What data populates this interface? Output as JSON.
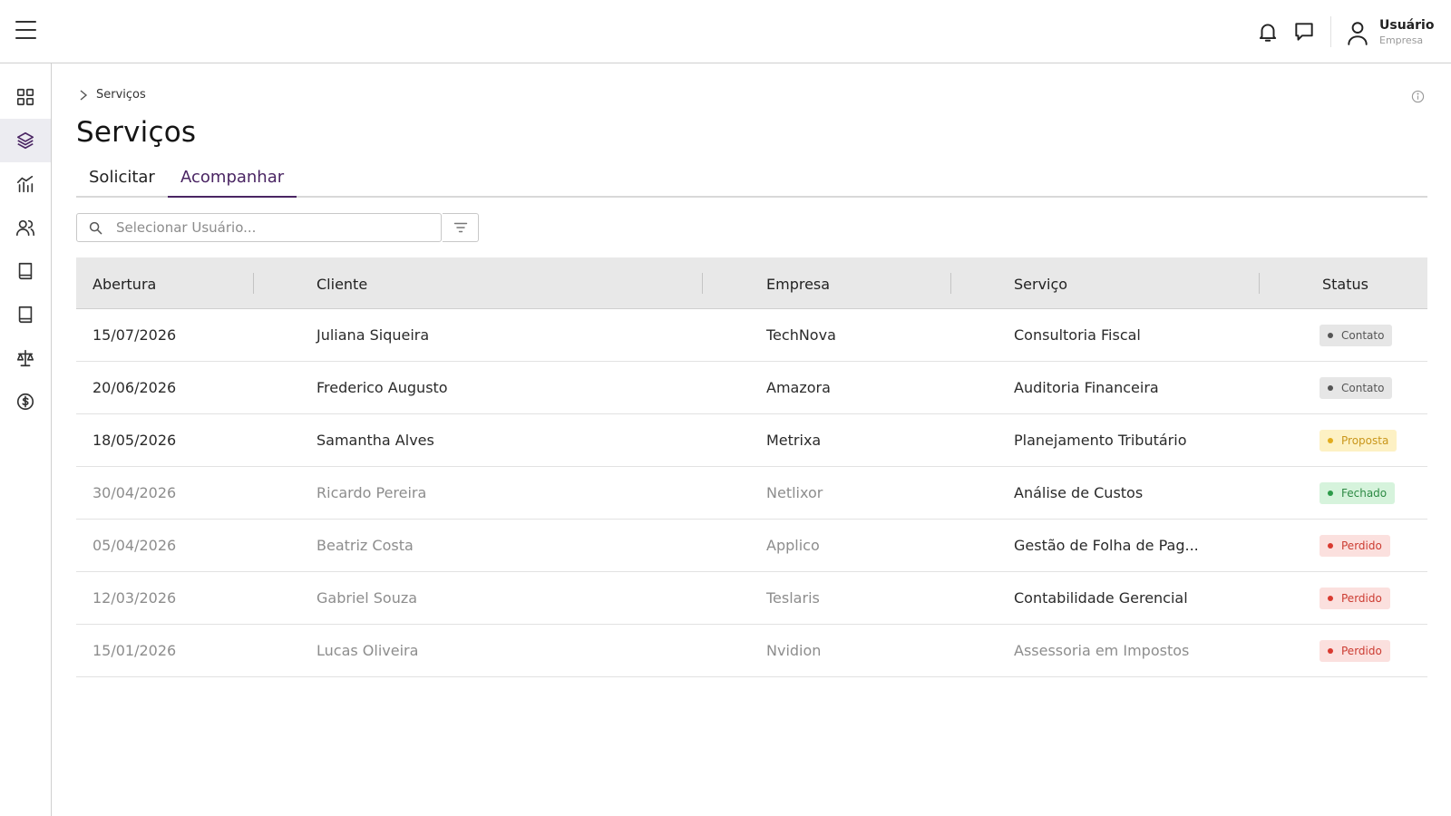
{
  "header": {
    "user_name": "Usuário",
    "user_company": "Empresa"
  },
  "sidebar": {
    "items": [
      {
        "icon": "grid-icon",
        "active": false
      },
      {
        "icon": "layers-icon",
        "active": true
      },
      {
        "icon": "chart-icon",
        "active": false
      },
      {
        "icon": "users-icon",
        "active": false
      },
      {
        "icon": "book-icon",
        "active": false
      },
      {
        "icon": "book-icon",
        "active": false
      },
      {
        "icon": "scale-icon",
        "active": false
      },
      {
        "icon": "dollar-icon",
        "active": false
      }
    ]
  },
  "breadcrumb": {
    "current": "Serviços"
  },
  "page": {
    "title": "Serviços"
  },
  "tabs": [
    {
      "label": "Solicitar",
      "selected": false
    },
    {
      "label": "Acompanhar",
      "selected": true
    }
  ],
  "search": {
    "placeholder": "Selecionar Usuário...",
    "value": ""
  },
  "table": {
    "columns": [
      "Abertura",
      "Cliente",
      "Empresa",
      "Serviço",
      "Status"
    ],
    "rows": [
      {
        "date": "15/07/2026",
        "client": "Juliana Siqueira",
        "company": "TechNova",
        "service": "Consultoria Fiscal",
        "status": "Contato"
      },
      {
        "date": "20/06/2026",
        "client": "Frederico Augusto",
        "company": "Amazora",
        "service": "Auditoria Financeira",
        "status": "Contato"
      },
      {
        "date": "18/05/2026",
        "client": "Samantha Alves",
        "company": "Metrixa",
        "service": "Planejamento Tributário",
        "status": "Proposta"
      },
      {
        "date": "30/04/2026",
        "client": "Ricardo Pereira",
        "company": "Netlixor",
        "service": "Análise de Custos",
        "status": "Fechado"
      },
      {
        "date": "05/04/2026",
        "client": "Beatriz Costa",
        "company": "Applico",
        "service": "Gestão de Folha de Pag...",
        "status": "Perdido"
      },
      {
        "date": "12/03/2026",
        "client": "Gabriel Souza",
        "company": "Teslaris",
        "service": "Contabilidade Gerencial",
        "status": "Perdido"
      },
      {
        "date": "15/01/2026",
        "client": "Lucas Oliveira",
        "company": "Nvidion",
        "service": "Assessoria em Impostos",
        "status": "Perdido"
      }
    ]
  },
  "colors": {
    "accent": "#4a2563",
    "contato": "#555555",
    "proposta": "#e2ac1e",
    "fechado": "#2d9b4a",
    "perdido": "#d93a30"
  }
}
